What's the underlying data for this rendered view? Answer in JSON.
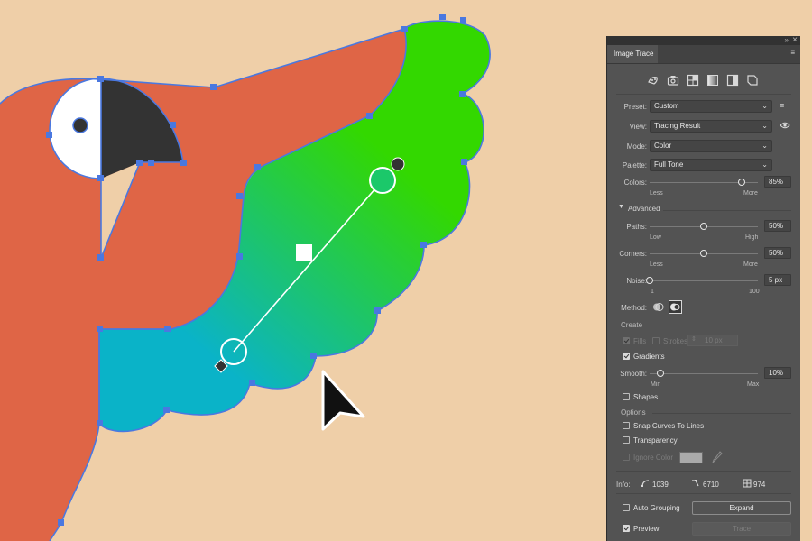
{
  "panel": {
    "title": "Image Trace",
    "preset_icons": [
      "auto-color-icon",
      "high-color-icon",
      "low-color-icon",
      "grayscale-icon",
      "black-white-icon",
      "outline-icon"
    ],
    "preset": {
      "label": "Preset:",
      "value": "Custom"
    },
    "view": {
      "label": "View:",
      "value": "Tracing Result"
    },
    "mode": {
      "label": "Mode:",
      "value": "Color"
    },
    "palette": {
      "label": "Palette:",
      "value": "Full Tone"
    },
    "colors": {
      "label": "Colors:",
      "value": "85%",
      "level": 0.85,
      "min_label": "Less",
      "max_label": "More"
    },
    "advanced": {
      "label": "Advanced",
      "expanded": true
    },
    "paths": {
      "label": "Paths:",
      "value": "50%",
      "level": 0.5,
      "min_label": "Low",
      "max_label": "High"
    },
    "corners": {
      "label": "Corners:",
      "value": "50%",
      "level": 0.5,
      "min_label": "Less",
      "max_label": "More"
    },
    "noise": {
      "label": "Noise:",
      "value": "5 px",
      "level": 0.0,
      "min_label": "1",
      "max_label": "100"
    },
    "method": {
      "label": "Method:",
      "options": [
        "abutting-method-icon",
        "overlapping-method-icon"
      ],
      "selected": "overlapping-method-icon"
    },
    "create": {
      "label": "Create",
      "fills": {
        "label": "Fills",
        "checked": true,
        "disabled": true
      },
      "strokes": {
        "label": "Strokes",
        "checked": false,
        "disabled": true,
        "value": "10 px"
      },
      "gradients": {
        "label": "Gradients",
        "checked": true
      }
    },
    "smooth": {
      "label": "Smooth:",
      "value": "10%",
      "level": 0.1,
      "min_label": "Min",
      "max_label": "Max"
    },
    "shapes": {
      "label": "Shapes",
      "checked": false
    },
    "options": {
      "label": "Options",
      "snap_curves": {
        "label": "Snap Curves To Lines",
        "checked": false
      },
      "transparency": {
        "label": "Transparency",
        "checked": false
      },
      "ignore_color": {
        "label": "Ignore Color",
        "checked": false,
        "disabled": true,
        "swatch": "#aaaaaa"
      }
    },
    "info": {
      "label": "Info:",
      "paths": "1039",
      "anchors": "6710",
      "colors": "974"
    },
    "auto_grouping": {
      "label": "Auto Grouping",
      "checked": false
    },
    "expand_label": "Expand",
    "preview": {
      "label": "Preview",
      "checked": true
    },
    "trace_label": "Trace"
  },
  "canvas": {
    "background": "#efcfa8",
    "body_color": "#df6546",
    "beak_color": "#333333",
    "eye_patch_color": "#ffffff",
    "gradient_start": "#0ab3c8",
    "gradient_end": "#33d800",
    "selection_color": "#4a78e0"
  }
}
